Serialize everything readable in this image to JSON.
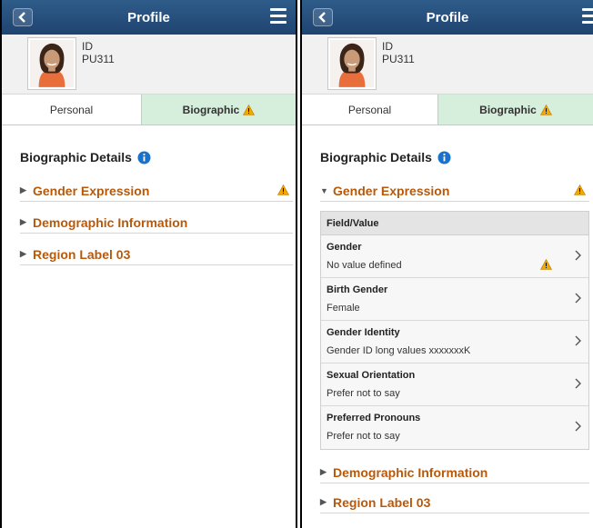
{
  "colors": {
    "header": "#2a5585",
    "active_tab": "#d6eedc",
    "group_title": "#b8590a",
    "warning": "#f5a700",
    "info": "#1a73c9"
  },
  "icons": {
    "back": "back-arrow-icon",
    "menu": "hamburger-menu-icon",
    "warning": "warning-triangle-icon",
    "info": "info-icon",
    "expand": "caret-right-icon",
    "collapse": "caret-down-icon",
    "chevron": "chevron-right-icon"
  },
  "left": {
    "header": {
      "title": "Profile"
    },
    "profile": {
      "id_label": "ID",
      "id_value": "PU311"
    },
    "tabs": [
      {
        "label": "Personal"
      },
      {
        "label": "Biographic"
      }
    ],
    "section_title": "Biographic Details",
    "groups": [
      {
        "label": "Gender Expression"
      },
      {
        "label": "Demographic Information"
      },
      {
        "label": "Region Label 03"
      }
    ]
  },
  "right": {
    "header": {
      "title": "Profile"
    },
    "profile": {
      "id_label": "ID",
      "id_value": "PU311"
    },
    "tabs": [
      {
        "label": "Personal"
      },
      {
        "label": "Biographic"
      }
    ],
    "section_title": "Biographic Details",
    "groups": [
      {
        "label": "Gender Expression"
      },
      {
        "label": "Demographic Information"
      },
      {
        "label": "Region Label 03"
      }
    ],
    "grid": {
      "header": "Field/Value",
      "rows": [
        {
          "field": "Gender",
          "value": "No value defined"
        },
        {
          "field": "Birth Gender",
          "value": "Female"
        },
        {
          "field": "Gender Identity",
          "value": "Gender ID long values xxxxxxxK"
        },
        {
          "field": "Sexual Orientation",
          "value": "Prefer not to say"
        },
        {
          "field": "Preferred Pronouns",
          "value": "Prefer not to say"
        }
      ]
    }
  }
}
